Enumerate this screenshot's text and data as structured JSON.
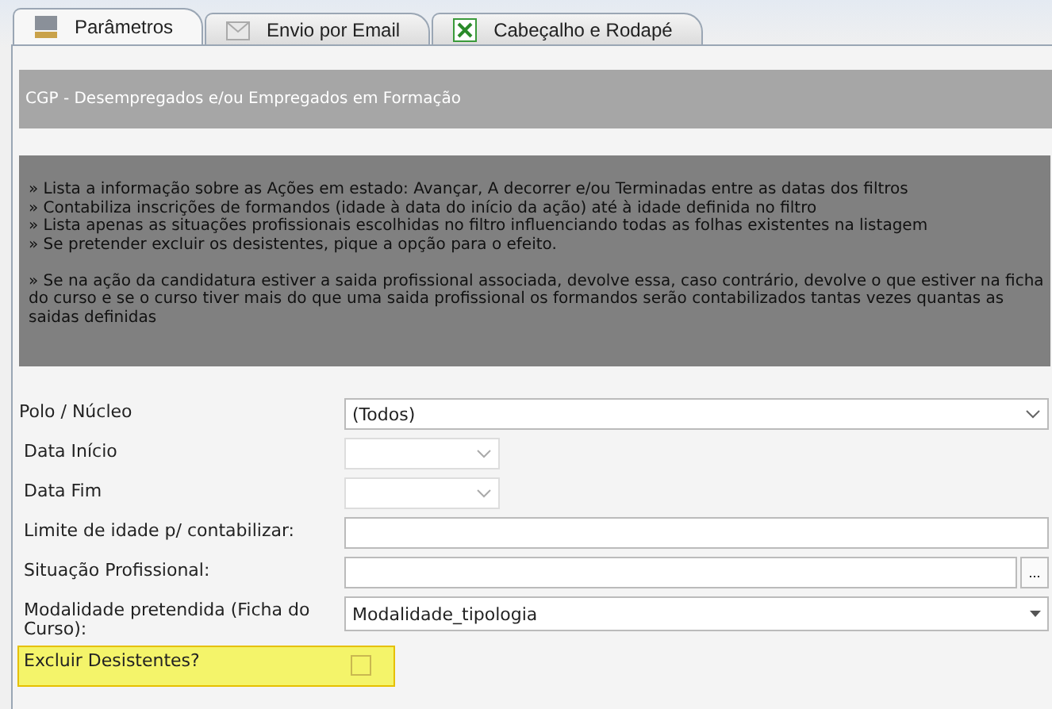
{
  "tabs": [
    {
      "label": "Parâmetros",
      "kind": "monitor",
      "selected": true
    },
    {
      "label": "Envio por Email",
      "kind": "envelope",
      "selected": false
    },
    {
      "label": "Cabeçalho e Rodapé",
      "kind": "sheet",
      "selected": false
    }
  ],
  "report_title": "CGP - Desempregados e/ou Empregados em Formação",
  "info_paragraphs": [
    [
      "» Lista a informação sobre as Ações em estado: Avançar, A decorrer e/ou Terminadas entre as datas dos filtros",
      "» Contabiliza inscrições de formandos (idade à data do início da ação) até à idade definida no filtro",
      "» Lista apenas as situações profissionais escolhidas no filtro influenciando todas as folhas existentes na listagem",
      "» Se pretender excluir os desistentes, pique a opção para o efeito."
    ],
    [
      "» Se na ação da candidatura estiver a saida profissional associada, devolve essa, caso contrário, devolve o que estiver na ficha do curso e se o curso tiver mais do que uma saida profissional os formandos serão contabilizados tantas vezes quantas as saidas definidas"
    ]
  ],
  "fields": [
    {
      "kind": "combo",
      "label": "Polo / Núcleo",
      "value": "(Todos)"
    },
    {
      "kind": "date",
      "label": "Data Início"
    },
    {
      "kind": "date",
      "label": "Data Fim"
    },
    {
      "kind": "text",
      "label": "Limite de idade p/ contabilizar:"
    },
    {
      "kind": "picker",
      "label": "Situação Profissional:",
      "button": "..."
    },
    {
      "kind": "dropdown",
      "label": "Modalidade pretendida (Ficha do Curso):",
      "value": "Modalidade_tipologia"
    },
    {
      "kind": "checkbox",
      "label": "Excluir Desistentes?",
      "checked": false,
      "highlighted": true
    }
  ]
}
